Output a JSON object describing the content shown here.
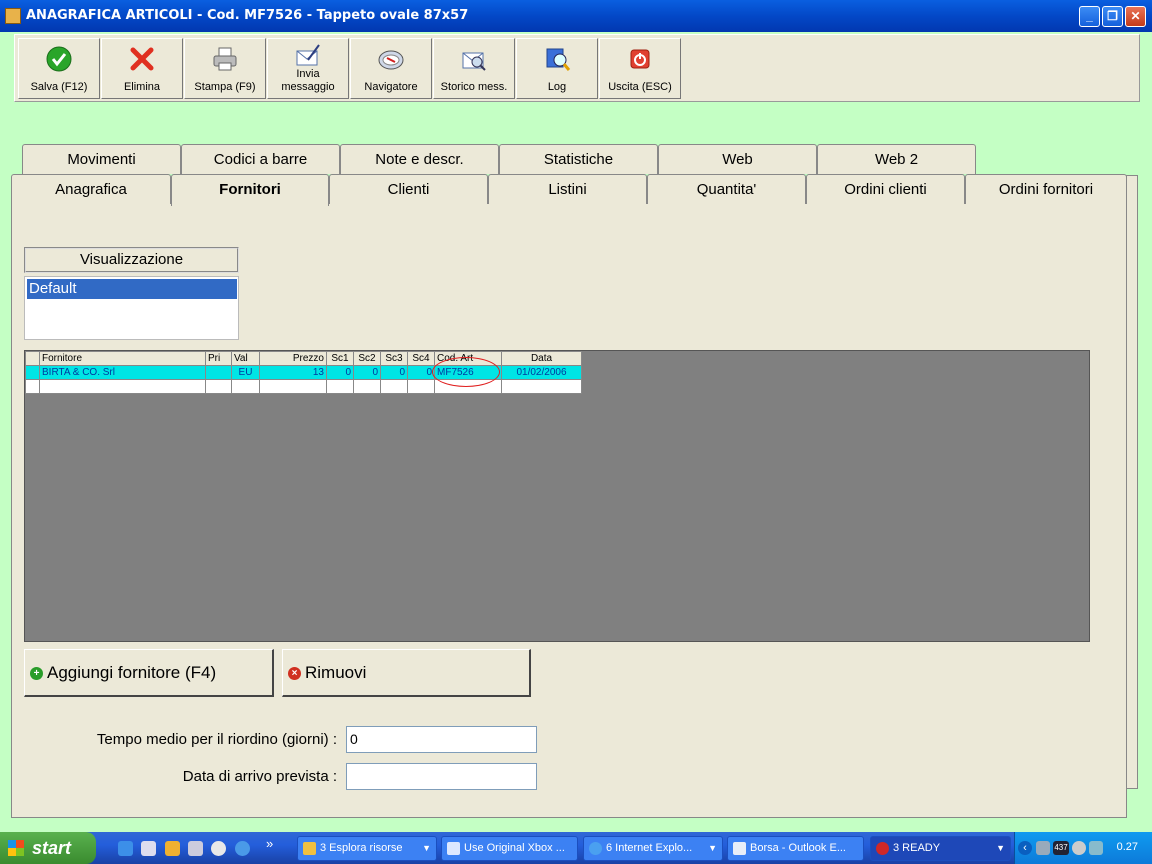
{
  "window": {
    "title": "ANAGRAFICA ARTICOLI - Cod. MF7526 - Tappeto ovale 87x57",
    "controls": [
      "_",
      "❐",
      "✕"
    ]
  },
  "toolbar": [
    {
      "name": "save-button",
      "label": "Salva (F12)",
      "icon": "checkmark-icon"
    },
    {
      "name": "delete-button",
      "label": "Elimina",
      "icon": "red-x-icon"
    },
    {
      "name": "print-button",
      "label": "Stampa (F9)",
      "icon": "printer-icon"
    },
    {
      "name": "send-message-button",
      "label": "Invia\nmessaggio",
      "icon": "envelope-pen-icon"
    },
    {
      "name": "navigator-button",
      "label": "Navigatore",
      "icon": "compass-icon"
    },
    {
      "name": "message-history-button",
      "label": "Storico mess.",
      "icon": "envelope-search-icon"
    },
    {
      "name": "log-button",
      "label": "Log",
      "icon": "log-search-icon"
    },
    {
      "name": "exit-button",
      "label": "Uscita (ESC)",
      "icon": "power-icon"
    }
  ],
  "tabs_top": [
    "Movimenti",
    "Codici a barre",
    "Note e descr.",
    "Statistiche",
    "Web",
    "Web 2"
  ],
  "tabs_bottom": [
    "Anagrafica",
    "Fornitori",
    "Clienti",
    "Listini",
    "Quantita'",
    "Ordini clienti",
    "Ordini fornitori"
  ],
  "active_tab": "Fornitori",
  "visualizzazione": {
    "header": "Visualizzazione",
    "items": [
      "Default"
    ]
  },
  "grid": {
    "columns": [
      "Fornitore",
      "Pri",
      "Val",
      "Prezzo",
      "Sc1",
      "Sc2",
      "Sc3",
      "Sc4",
      "Cod. Art",
      "Data"
    ],
    "rows": [
      [
        "BIRTA & CO. Srl",
        "",
        "EU",
        "13",
        "0",
        "0",
        "0",
        "0",
        "MF7526",
        "01/02/2006"
      ]
    ]
  },
  "buttons": {
    "add_supplier": "Aggiungi fornitore (F4)",
    "remove": "Rimuovi"
  },
  "fields": {
    "reorder_label": "Tempo medio per il riordino (giorni) :",
    "reorder_value": "0",
    "arrival_label": "Data di arrivo prevista :",
    "arrival_value": ""
  },
  "taskbar": {
    "start": "start",
    "more": "»",
    "tasks": [
      {
        "label": "3 Esplora risorse",
        "dropdown": true,
        "active": false
      },
      {
        "label": "Use Original Xbox ...",
        "dropdown": false,
        "active": false
      },
      {
        "label": "6 Internet Explo...",
        "dropdown": true,
        "active": false
      },
      {
        "label": "Borsa - Outlook E...",
        "dropdown": false,
        "active": false
      },
      {
        "label": "3 READY",
        "dropdown": true,
        "active": true
      }
    ],
    "tray_badge": "437",
    "clock": "0.27"
  },
  "colors": {
    "background": "#c4ffc4",
    "selection": "#316ac5",
    "row_highlight": "#00e5e5",
    "annotation_circle": "#e02020"
  }
}
